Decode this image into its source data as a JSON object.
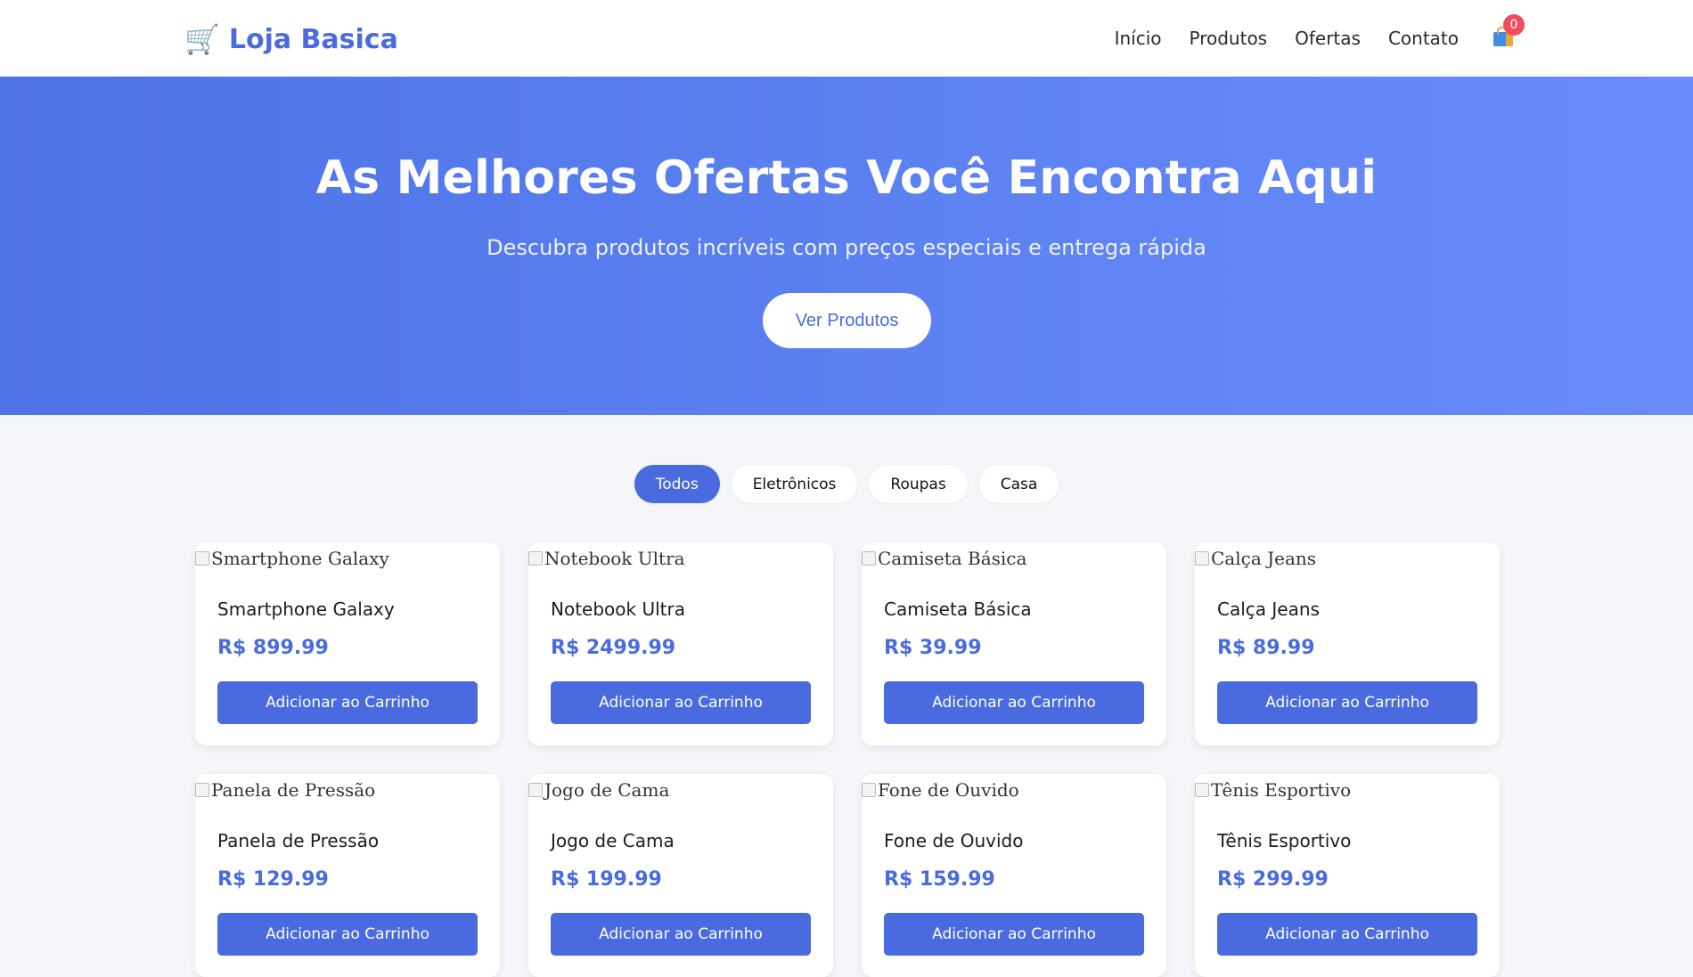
{
  "header": {
    "logo_icon": "shopping-cart-icon",
    "logo_text": "Loja Basica",
    "nav": [
      "Início",
      "Produtos",
      "Ofertas",
      "Contato"
    ],
    "cart_count": "0"
  },
  "hero": {
    "title": "As Melhores Ofertas Você Encontra Aqui",
    "subtitle": "Descubra produtos incríveis com preços especiais e entrega rápida",
    "cta": "Ver Produtos"
  },
  "filters": [
    {
      "label": "Todos",
      "active": true
    },
    {
      "label": "Eletrônicos",
      "active": false
    },
    {
      "label": "Roupas",
      "active": false
    },
    {
      "label": "Casa",
      "active": false
    }
  ],
  "add_to_cart_label": "Adicionar ao Carrinho",
  "products": [
    {
      "name": "Smartphone Galaxy",
      "price": "R$ 899.99"
    },
    {
      "name": "Notebook Ultra",
      "price": "R$ 2499.99"
    },
    {
      "name": "Camiseta Básica",
      "price": "R$ 39.99"
    },
    {
      "name": "Calça Jeans",
      "price": "R$ 89.99"
    },
    {
      "name": "Panela de Pressão",
      "price": "R$ 129.99"
    },
    {
      "name": "Jogo de Cama",
      "price": "R$ 199.99"
    },
    {
      "name": "Fone de Ouvido",
      "price": "R$ 159.99"
    },
    {
      "name": "Tênis Esportivo",
      "price": "R$ 299.99"
    }
  ],
  "colors": {
    "accent": "#4a6be0",
    "hero_start": "#4d72e6",
    "hero_end": "#6a8cfb",
    "badge": "#f04e5e",
    "background": "#f4f6fa"
  }
}
